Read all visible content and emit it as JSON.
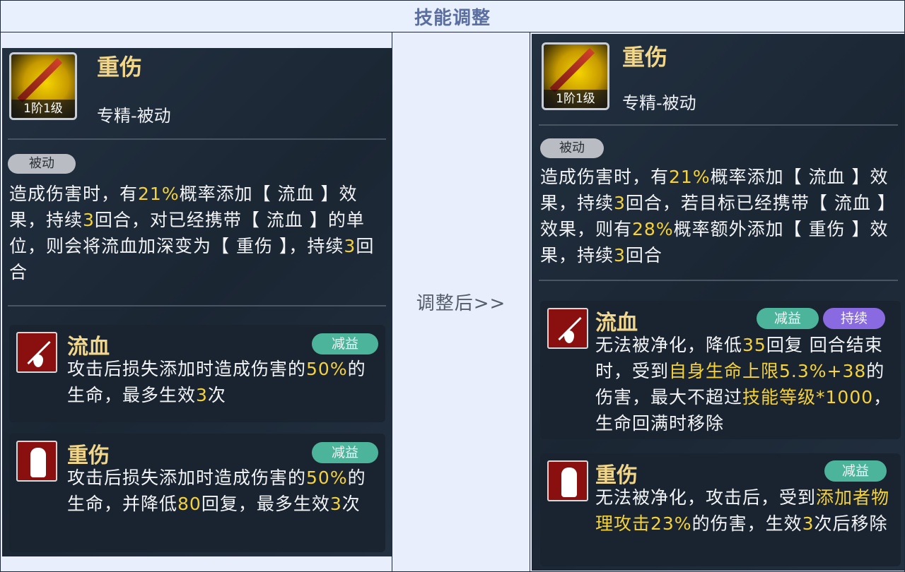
{
  "header": {
    "title": "技能调整"
  },
  "middle": {
    "arrow_text": "调整后>>"
  },
  "left": {
    "skill": {
      "name": "重伤",
      "level_badge": "1阶1级",
      "type": "专精-被动"
    },
    "pill": "被动",
    "description": {
      "parts": [
        "造成伤害时，有",
        "21%",
        "概率添加【 流血 】效果，持续",
        "3",
        "回合，对已经携带【 流血 】的单位，则会将流血加深变为【 重伤 】，持续",
        "3",
        "回合"
      ]
    },
    "effects": [
      {
        "name": "流血",
        "icon": "spear-blood-icon",
        "tags": [
          "减益"
        ],
        "parts": [
          "攻击后损失添加时造成伤害的",
          "50%",
          "的生命，最多生效",
          "3",
          "次"
        ]
      },
      {
        "name": "重伤",
        "icon": "wounded-figure-icon",
        "tags": [
          "减益"
        ],
        "parts": [
          "攻击后损失添加时造成伤害的",
          "50%",
          "的生命，并降低",
          "80",
          "回复，最多生效",
          "3",
          "次"
        ]
      }
    ]
  },
  "right": {
    "skill": {
      "name": "重伤",
      "level_badge": "1阶1级",
      "type": "专精-被动"
    },
    "pill": "被动",
    "description": {
      "parts": [
        "造成伤害时，有",
        "21%",
        "概率添加【 流血 】效果，持续",
        "3",
        "回合，若目标已经携带【 流血 】效果，则有",
        "28%",
        "概率额外添加【 重伤 】效果，持续",
        "3",
        "回合"
      ]
    },
    "effects": [
      {
        "name": "流血",
        "icon": "spear-blood-icon",
        "tags": [
          "减益",
          "持续"
        ],
        "parts": [
          "无法被净化，降低",
          "35",
          "回复 回合结束时，受到",
          "自身生命上限5.3%+38",
          "的伤害，最大不超过",
          "技能等级*1000",
          "，生命回满时移除"
        ]
      },
      {
        "name": "重伤",
        "icon": "wounded-figure-icon",
        "tags": [
          "减益"
        ],
        "parts": [
          "无法被净化，攻击后，受到",
          "添加者物理攻击23%",
          "的伤害，生效",
          "3",
          "次后移除"
        ]
      }
    ]
  },
  "colors": {
    "highlight": "#f5d23a",
    "name": "#f2d68a",
    "debuff_tag": "#4db49c",
    "duration_tag": "#8a6ae0",
    "panel": "#1f2b38",
    "header_text": "#5a6fa0"
  }
}
